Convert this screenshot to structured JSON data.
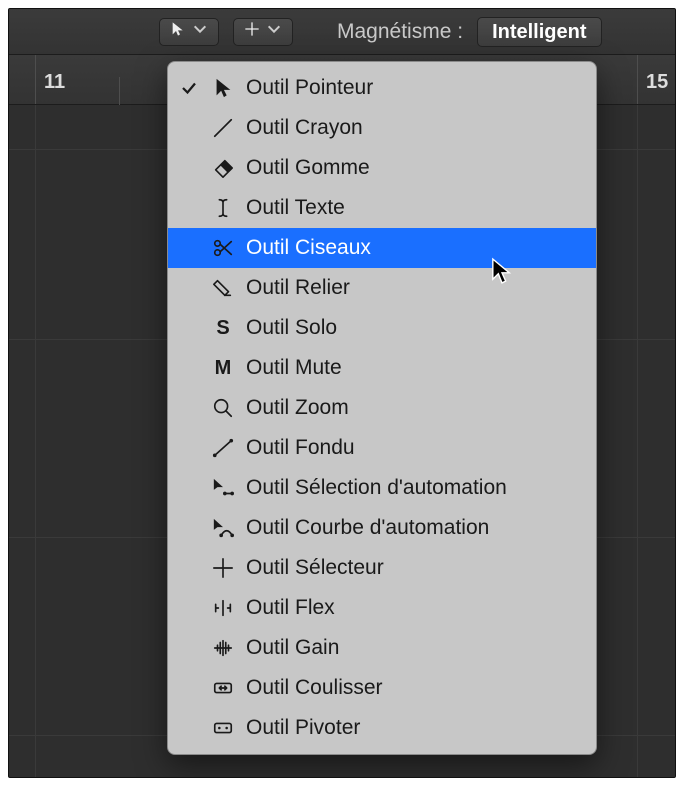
{
  "toolbar": {
    "snap_label": "Magnétisme :",
    "snap_value": "Intelligent"
  },
  "ruler": {
    "marks": [
      "11",
      "15"
    ]
  },
  "menu": {
    "items": [
      {
        "id": "pointer",
        "label": "Outil Pointeur",
        "checked": true,
        "icon": "cursor-icon"
      },
      {
        "id": "pencil",
        "label": "Outil Crayon",
        "checked": false,
        "icon": "pencil-icon"
      },
      {
        "id": "eraser",
        "label": "Outil Gomme",
        "checked": false,
        "icon": "eraser-icon"
      },
      {
        "id": "text",
        "label": "Outil Texte",
        "checked": false,
        "icon": "text-cursor-icon"
      },
      {
        "id": "scissors",
        "label": "Outil Ciseaux",
        "checked": false,
        "icon": "scissors-icon",
        "selected": true
      },
      {
        "id": "glue",
        "label": "Outil Relier",
        "checked": false,
        "icon": "glue-icon"
      },
      {
        "id": "solo",
        "label": "Outil Solo",
        "checked": false,
        "icon": "letter-S"
      },
      {
        "id": "mute",
        "label": "Outil Mute",
        "checked": false,
        "icon": "letter-M"
      },
      {
        "id": "zoom",
        "label": "Outil Zoom",
        "checked": false,
        "icon": "zoom-icon"
      },
      {
        "id": "fade",
        "label": "Outil Fondu",
        "checked": false,
        "icon": "fade-icon"
      },
      {
        "id": "autosel",
        "label": "Outil Sélection d'automation",
        "checked": false,
        "icon": "automation-select-icon"
      },
      {
        "id": "autocurve",
        "label": "Outil Courbe d'automation",
        "checked": false,
        "icon": "automation-curve-icon"
      },
      {
        "id": "marquee",
        "label": "Outil Sélecteur",
        "checked": false,
        "icon": "crosshair-icon"
      },
      {
        "id": "flex",
        "label": "Outil Flex",
        "checked": false,
        "icon": "flex-icon"
      },
      {
        "id": "gain",
        "label": "Outil Gain",
        "checked": false,
        "icon": "gain-icon"
      },
      {
        "id": "slip",
        "label": "Outil Coulisser",
        "checked": false,
        "icon": "slip-icon"
      },
      {
        "id": "rotate",
        "label": "Outil Pivoter",
        "checked": false,
        "icon": "rotate-icon"
      }
    ]
  }
}
